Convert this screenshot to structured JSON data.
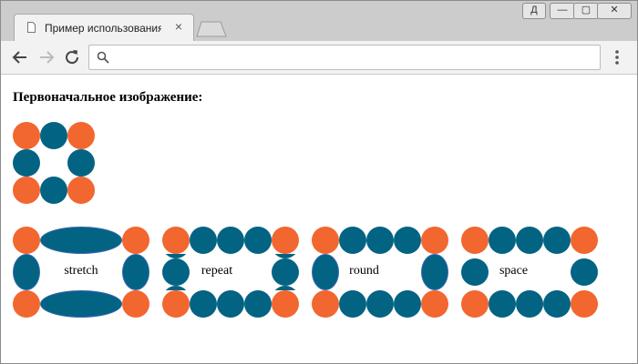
{
  "window": {
    "tab_title": "Пример использования свойства",
    "tab_close_glyph": "×",
    "controls": {
      "user": "Д",
      "minimize": "—",
      "maximize": "▢",
      "close": "✕"
    }
  },
  "toolbar": {
    "back_glyph": "←",
    "forward_glyph": "→",
    "reload_glyph": "↻",
    "address_value": "",
    "address_placeholder": "",
    "menu_glyph": "⋮"
  },
  "page": {
    "heading": "Первоначальное изображение:",
    "examples": [
      {
        "label": "stretch"
      },
      {
        "label": "repeat"
      },
      {
        "label": "round"
      },
      {
        "label": "space"
      }
    ]
  },
  "colors": {
    "orange": "#f2662f",
    "teal": "#036383"
  }
}
